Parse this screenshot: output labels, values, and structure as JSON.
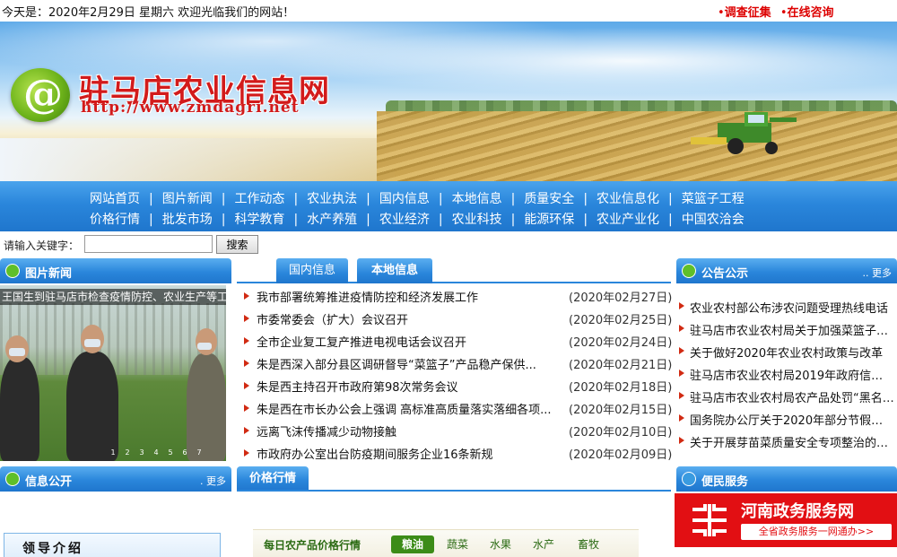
{
  "topbar": {
    "date_text": "今天是：2020年2月29日 星期六  欢迎光临我们的网站！",
    "link_survey": "调查征集",
    "link_consult": "在线咨询",
    "link_color": "#dd0000"
  },
  "banner": {
    "logo_glyph": "@",
    "site_name": "驻马店农业信息网",
    "site_url": "http://www.zmdagri.net"
  },
  "nav": {
    "row1": [
      "网站首页",
      "图片新闻",
      "工作动态",
      "农业执法",
      "国内信息",
      "本地信息",
      "质量安全",
      "农业信息化",
      "菜篮子工程"
    ],
    "row2": [
      "价格行情",
      "批发市场",
      "科学教育",
      "水产养殖",
      "农业经济",
      "农业科技",
      "能源环保",
      "农业产业化",
      "中国农洽会"
    ],
    "bar_color": "#2a86db"
  },
  "search": {
    "label": "请输入关键字：",
    "value": "",
    "button": "搜索"
  },
  "photo_news": {
    "title": "图片新闻",
    "caption": "王国生到驻马店市检查疫情防控、农业生产等工",
    "pager": [
      "1",
      "2",
      "3",
      "4",
      "5",
      "6",
      "7"
    ]
  },
  "news_tabs": {
    "tabs": [
      "国内信息",
      "本地信息"
    ],
    "active": "本地信息",
    "items": [
      {
        "title": "我市部署统筹推进疫情防控和经济发展工作",
        "date": "(2020年02月27日)"
      },
      {
        "title": "市委常委会（扩大）会议召开",
        "date": "(2020年02月25日)"
      },
      {
        "title": "全市企业复工复产推进电视电话会议召开",
        "date": "(2020年02月24日)"
      },
      {
        "title": "朱是西深入部分县区调研督导“菜篮子”产品稳产保供...",
        "date": "(2020年02月21日)"
      },
      {
        "title": "朱是西主持召开市政府第98次常务会议",
        "date": "(2020年02月18日)"
      },
      {
        "title": "朱是西在市长办公会上强调 高标准高质量落实落细各项...",
        "date": "(2020年02月15日)"
      },
      {
        "title": "远离飞沫传播减少动物接触",
        "date": "(2020年02月10日)"
      },
      {
        "title": "市政府办公室出台防疫期间服务企业16条新规",
        "date": "(2020年02月09日)"
      }
    ]
  },
  "notice": {
    "title": "公告公示",
    "more": "更多",
    "items": [
      "农业农村部公布涉农问题受理热线电话",
      "驻马店市农业农村局关于加强菜篮子工程",
      "关于做好2020年农业农村政策与改革",
      "驻马店市农业农村局2019年政府信息公开",
      "驻马店市农业农村局农产品处罚“黑名单”",
      "国务院办公厅关于2020年部分节假日安排",
      "关于开展芽苗菜质量安全专项整治的通知"
    ]
  },
  "info_open": {
    "title": "信息公开",
    "more": "更多"
  },
  "price": {
    "title": "价格行情"
  },
  "service": {
    "title": "便民服务"
  },
  "leader": {
    "title": "领导介绍"
  },
  "daily": {
    "label": "每日农产品价格行情",
    "categories": [
      "粮油",
      "蔬菜",
      "水果",
      "水产",
      "畜牧"
    ],
    "active": "粮油"
  },
  "gov_banner": {
    "name": "河南政务服务网",
    "sub": "全省政务服务一网通办>>",
    "color": "#e20f13"
  }
}
